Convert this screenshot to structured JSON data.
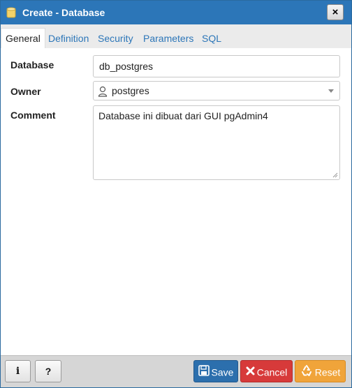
{
  "dialog": {
    "title": "Create - Database",
    "close_label": "×"
  },
  "tabs": [
    {
      "label": "General",
      "active": true
    },
    {
      "label": "Definition",
      "active": false
    },
    {
      "label": "Security",
      "active": false
    },
    {
      "label": "Parameters",
      "active": false
    },
    {
      "label": "SQL",
      "active": false
    }
  ],
  "form": {
    "database": {
      "label": "Database",
      "value": "db_postgres"
    },
    "owner": {
      "label": "Owner",
      "value": "postgres"
    },
    "comment": {
      "label": "Comment",
      "value": "Database ini dibuat dari GUI pgAdmin4"
    }
  },
  "footer": {
    "info_label": "i",
    "help_label": "?",
    "save_label": "Save",
    "cancel_label": "Cancel",
    "reset_label": "Reset"
  },
  "colors": {
    "titlebar": "#2c76b8",
    "save": "#2c6fad",
    "cancel": "#d73a3a",
    "reset": "#f0a43a"
  },
  "icons": {
    "title": "database-icon",
    "owner": "user-icon",
    "save": "floppy-disk-icon",
    "cancel": "x-icon",
    "reset": "recycle-icon"
  }
}
